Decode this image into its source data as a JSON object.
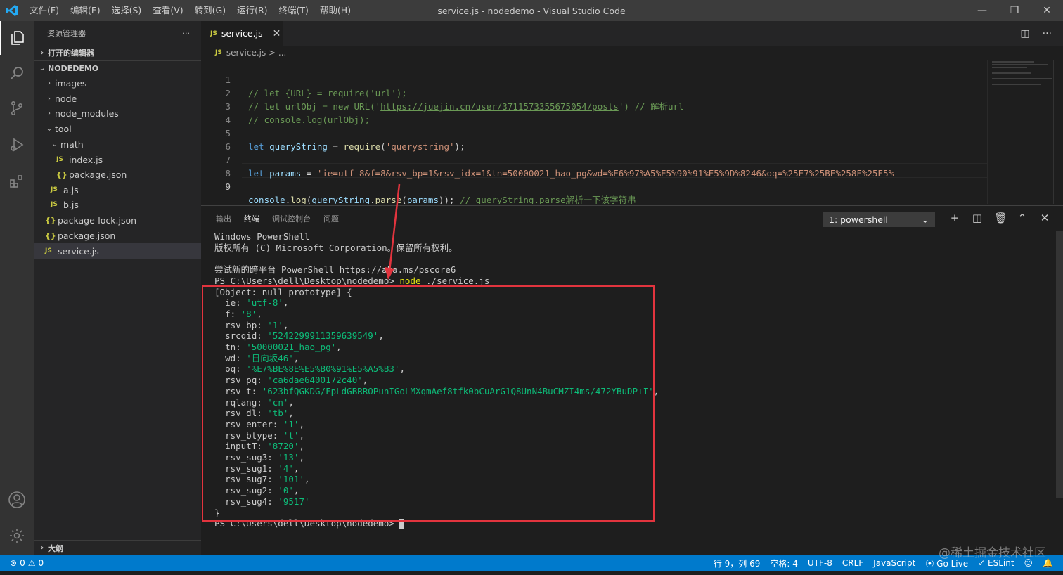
{
  "titlebar": {
    "menu": [
      "文件(F)",
      "编辑(E)",
      "选择(S)",
      "查看(V)",
      "转到(G)",
      "运行(R)",
      "终端(T)",
      "帮助(H)"
    ],
    "window_title": "service.js - nodedemo - Visual Studio Code"
  },
  "sidebar": {
    "header": "资源管理器",
    "more": "···",
    "open_editors": "打开的编辑器",
    "project": "NODEDEMO",
    "items": [
      {
        "label": "images",
        "kind": "folder",
        "expanded": false
      },
      {
        "label": "node",
        "kind": "folder",
        "expanded": false
      },
      {
        "label": "node_modules",
        "kind": "folder",
        "expanded": false
      },
      {
        "label": "tool",
        "kind": "folder",
        "expanded": true
      },
      {
        "label": "math",
        "kind": "folder",
        "expanded": true
      },
      {
        "label": "index.js",
        "kind": "js"
      },
      {
        "label": "package.json",
        "kind": "json"
      },
      {
        "label": "a.js",
        "kind": "js"
      },
      {
        "label": "b.js",
        "kind": "js"
      },
      {
        "label": "package-lock.json",
        "kind": "json"
      },
      {
        "label": "package.json",
        "kind": "json"
      },
      {
        "label": "service.js",
        "kind": "js",
        "selected": true
      }
    ],
    "outline": "大纲"
  },
  "editor": {
    "tab_label": "service.js",
    "file_badge": "JS",
    "breadcrumb": "service.js > ...",
    "line_numbers": [
      "1",
      "2",
      "3",
      "4",
      "5",
      "6",
      "7",
      "8",
      "9"
    ],
    "code": {
      "l1": "// let {URL} = require('url');",
      "l2a": "// let urlObj = new URL('",
      "l2b": "https://juejin.cn/user/3711573355675054/posts",
      "l2c": "') // 解析url",
      "l3": "// console.log(urlObj);",
      "l5_kw": "let",
      "l5_var": "queryString",
      "l5_op": " = ",
      "l5_fn": "require",
      "l5_str": "'querystring'",
      "l5_end": ");",
      "l7_kw": "let",
      "l7_var": "params",
      "l7_op": " = ",
      "l7_str": "'ie=utf-8&f=8&rsv_bp=1&rsv_idx=1&tn=50000021_hao_pg&wd=%E6%97%A5%E5%90%91%E5%9D%8246&oq=%25E7%25BE%258E%25E5%",
      "l9_obj": "console",
      "l9_fn": "log",
      "l9_var": "queryString",
      "l9_fn2": "parse",
      "l9_arg": "params",
      "l9_com": "// queryString.parse解析一下该字符串"
    }
  },
  "panel": {
    "tabs": [
      "输出",
      "终端",
      "调试控制台",
      "问题"
    ],
    "active_tab": "终端",
    "terminal_select": "1: powershell",
    "terminal": {
      "l1": "Windows PowerShell",
      "l2": "版权所有 (C) Microsoft Corporation。保留所有权利。",
      "l4": "尝试新的跨平台 PowerShell https://aka.ms/pscore6",
      "prompt": "PS C:\\Users\\dell\\Desktop\\nodedemo> ",
      "cmd_node": "node",
      "cmd_rest": " ./service.js",
      "obj_head": "[Object: null prototype] {",
      "entries": [
        {
          "k": "ie",
          "v": "'utf-8'"
        },
        {
          "k": "f",
          "v": "'8'"
        },
        {
          "k": "rsv_bp",
          "v": "'1'"
        },
        {
          "k": "srcqid",
          "v": "'5242299911359639549'"
        },
        {
          "k": "tn",
          "v": "'50000021_hao_pg'"
        },
        {
          "k": "wd",
          "v": "'日向坂46'"
        },
        {
          "k": "oq",
          "v": "'%E7%BE%8E%E5%B0%91%E5%A5%B3'"
        },
        {
          "k": "rsv_pq",
          "v": "'ca6dae6400172c40'"
        },
        {
          "k": "rsv_t",
          "v": "'623bfQGKDG/FpLdGBRROPunIGoLMXqmAef8tfk0bCuArG1Q8UnN4BuCMZI4ms/472YBuDP+I'"
        },
        {
          "k": "rqlang",
          "v": "'cn'"
        },
        {
          "k": "rsv_dl",
          "v": "'tb'"
        },
        {
          "k": "rsv_enter",
          "v": "'1'"
        },
        {
          "k": "rsv_btype",
          "v": "'t'"
        },
        {
          "k": "inputT",
          "v": "'8720'"
        },
        {
          "k": "rsv_sug3",
          "v": "'13'"
        },
        {
          "k": "rsv_sug1",
          "v": "'4'"
        },
        {
          "k": "rsv_sug7",
          "v": "'101'"
        },
        {
          "k": "rsv_sug2",
          "v": "'0'"
        },
        {
          "k": "rsv_sug4",
          "v": "'9517'"
        }
      ],
      "obj_tail": "}",
      "prompt2": "PS C:\\Users\\dell\\Desktop\\nodedemo> "
    }
  },
  "statusbar": {
    "errors": "0",
    "warnings": "0",
    "position": "行 9，列 69",
    "spaces": "空格: 4",
    "encoding": "UTF-8",
    "eol": "CRLF",
    "language": "JavaScript",
    "golive": "Go Live",
    "eslint": "ESLint"
  },
  "watermark": "@稀土掘金技术社区",
  "colors": {
    "accent": "#007acc",
    "highlight_box": "#e2343e"
  }
}
